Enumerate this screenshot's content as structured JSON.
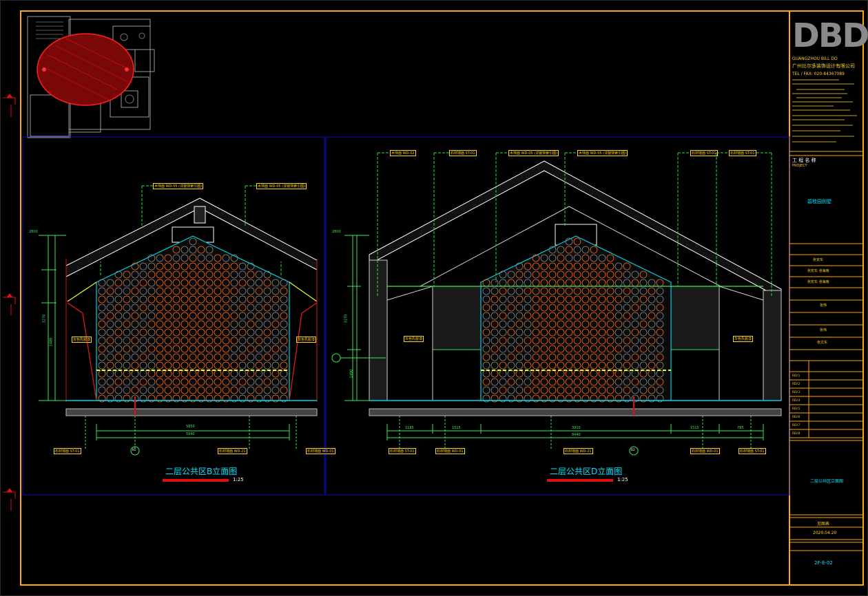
{
  "colors": {
    "frame": "#ffaa00",
    "viewport": "#1010c8",
    "roof": "#ffffff",
    "leader": "#26e03a",
    "dim": "#3ee85a",
    "ceiling": "#00d0e0",
    "circles_orange": "#ff6a1a",
    "circles_gray": "#8a8a8a",
    "title_text": "#00e5ff",
    "title_bar": "#e01010",
    "label_yellow": "#ffd21f",
    "section_red": "#d01818",
    "floor": "#bdbdbd"
  },
  "title_block": {
    "logo": "DBD",
    "company_en": "GUANGZHOU BILL DO",
    "company_cn": "广州比尔多装饰设计有限公司",
    "tel": "TEL / FAX: 020-84367089",
    "project_label": "工 程 名 称",
    "project_sub": "PROJECT",
    "project_name": "碧桂园别墅",
    "drawing_title": "二层公共区立面图",
    "date": "2020.04.20",
    "designer": "见图表",
    "drawing_no": "2F-E-02",
    "rev_rows": [
      "REV.1",
      "REV.2",
      "REV.3",
      "REV.4",
      "REV.5",
      "REV.6",
      "REV.7",
      "REV.8"
    ],
    "sign_rows": [
      "张安东",
      "张宏东  张海南",
      "张宏东  张海南",
      "张伟",
      "张伟",
      "张文东"
    ]
  },
  "elevation_b": {
    "title": "二层公共区B立面图",
    "scale": "1:25",
    "dims_bottom": [
      "5850",
      "5940"
    ],
    "dims_left": [
      "2800",
      "3270",
      "1480"
    ],
    "tags_top": [
      "木饰面 WD-05 (详装饰索引图)",
      "木饰面 WD-05 (详装饰索引图)"
    ],
    "tags_bottom": [
      "石材墙面 ST-01",
      "石材墙面 WD-21",
      "石材墙面 WD-01"
    ],
    "side_labels": [
      "灰色乳胶漆",
      "灰色乳胶漆"
    ],
    "axis": "B1"
  },
  "elevation_d": {
    "title": "二层公共区D立面图",
    "scale": "1:25",
    "dims_bottom": [
      "1185",
      "1515",
      "3910",
      "1515",
      "785",
      "8440"
    ],
    "dims_left": [
      "2800",
      "3270",
      "1490"
    ],
    "tags_top": [
      "木饰面 WD-02",
      "石材墙面 ST-01",
      "木饰面 WD-05 (详装饰索引图)",
      "木饰面 WD-05 (详装饰索引图)",
      "石材墙面 ST-01",
      "石材墙面 ST-01"
    ],
    "tags_bottom": [
      "石材墙面 ST-01",
      "石材墙面 WD-01",
      "石材墙面 WD-21",
      "石材墙面 WD-01",
      "石材墙面 ST-01"
    ],
    "side_labels": [
      "灰色乳胶漆",
      "灰色乳胶漆"
    ],
    "axis": "D2"
  }
}
